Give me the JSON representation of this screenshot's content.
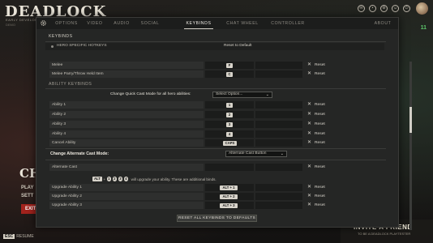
{
  "background": {
    "logo": "DEADLOCK",
    "logo_sub": "EARLY DEVELOPMENT BUILD",
    "logo_ver": "DEMO",
    "menu_partial": "CH",
    "side_item_1": "PLAY",
    "side_item_2": "SETT",
    "exit_label": "EXIT",
    "esc_key": "ESC",
    "esc_label": "RESUME",
    "invite_title": "INVITE A FRIEND",
    "invite_sub": "TO BE A DEADLOCK PLAYTESTER",
    "right_counter": "11"
  },
  "tabs": [
    {
      "label": "OPTIONS"
    },
    {
      "label": "VIDEO"
    },
    {
      "label": "AUDIO"
    },
    {
      "label": "SOCIAL"
    },
    {
      "label": "KEYBINDS",
      "active": true
    },
    {
      "label": "CHAT WHEEL"
    },
    {
      "label": "CONTROLLER"
    },
    {
      "label": "ABOUT"
    }
  ],
  "keybinds": {
    "title": "KEYBINDS",
    "hero_specific_label": "HERO SPECIFIC HOTKEYS",
    "reset_to_default": "Reset to Default",
    "reset_label": "Reset",
    "melee_rows": [
      {
        "label": "Melee",
        "key": "F"
      },
      {
        "label": "Melee Parry/Throw Held Item",
        "key": "C"
      }
    ],
    "ability_header": "ABILITY KEYBINDS",
    "quick_cast_label": "Change Quick Cast Mode for all hero abilities:",
    "quick_cast_placeholder": "Select Option...",
    "ability_rows": [
      {
        "label": "Ability 1",
        "key": "1"
      },
      {
        "label": "Ability 2",
        "key": "2"
      },
      {
        "label": "Ability 3",
        "key": "3"
      },
      {
        "label": "Ability 4",
        "key": "4"
      },
      {
        "label": "Cancel Ability",
        "key": "CAPS"
      }
    ],
    "alt_cast_title": "Change Alternate Cast Mode:",
    "alt_cast_value": "Alternate Cast Button",
    "alt_cast_row": {
      "label": "Alternate Cast"
    },
    "upgrade_hint": {
      "mod": "ALT",
      "plus": "+",
      "keys": [
        "1",
        "2",
        "3",
        "4"
      ],
      "text": "will upgrade your ability. These are additional binds."
    },
    "upgrade_rows": [
      {
        "label": "Upgrade Ability 1",
        "key": "ALT + 1"
      },
      {
        "label": "Upgrade Ability 2",
        "key": "ALT + 2"
      },
      {
        "label": "Upgrade Ability 3",
        "key": "ALT + 3"
      }
    ],
    "reset_all": "RESET ALL KEYBINDS TO DEFAULTS"
  }
}
